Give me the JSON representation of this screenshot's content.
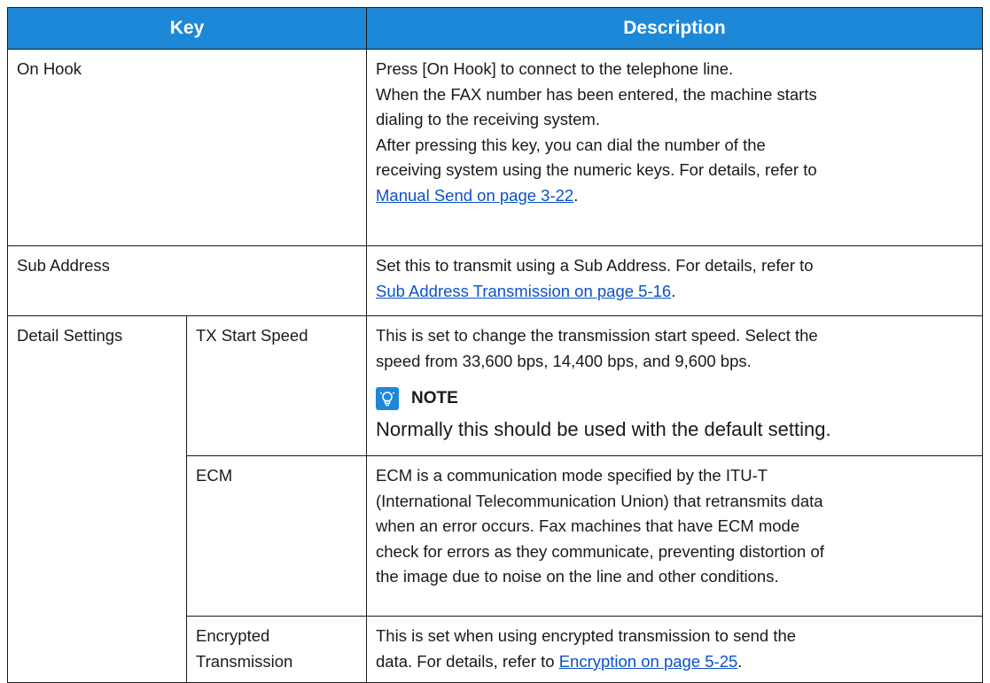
{
  "table": {
    "header": {
      "key": "Key",
      "description": "Description"
    },
    "on_hook": {
      "key": "On Hook",
      "lines": [
        "Press [On Hook] to connect to the telephone line.",
        "When the FAX number has been entered, the machine starts",
        "dialing to the receiving system.",
        "After pressing this key, you can dial the number of the",
        "receiving system using the numeric keys. For details, refer to"
      ],
      "link": "Manual Send on page 3-22",
      "end": "."
    },
    "sub_address": {
      "key": "Sub Address",
      "lines": [
        "Set this to transmit using a Sub Address. For details, refer to"
      ],
      "link": "Sub Address Transmission on page 5-16",
      "end": "."
    },
    "detail_settings": {
      "key": "Detail Settings",
      "tx_start_speed": {
        "key": "TX Start Speed",
        "lines": [
          "This is set to change the transmission start speed. Select the",
          "speed from 33,600 bps, 14,400 bps, and 9,600 bps."
        ],
        "note_title": "NOTE",
        "note_text": "Normally this should be used with the default setting."
      },
      "ecm": {
        "key": "ECM",
        "lines": [
          "ECM is a communication mode specified by the ITU-T",
          "(International Telecommunication Union) that retransmits data",
          "when an error occurs. Fax machines that have ECM mode",
          "check for errors as they communicate, preventing distortion of",
          "the image due to noise on the line and other conditions."
        ]
      },
      "encrypted": {
        "key_lines": [
          "Encrypted",
          "Transmission"
        ],
        "lines": [
          "This is set when using encrypted transmission to send the"
        ],
        "pre_link": "data. For details, refer to ",
        "link": "Encryption on page 5-25",
        "end": "."
      }
    }
  },
  "icons": {
    "note": "lightbulb-note-icon"
  },
  "colors": {
    "header_bg": "#1e88d8",
    "link": "#0a52c8",
    "border": "#1a1a1a"
  }
}
